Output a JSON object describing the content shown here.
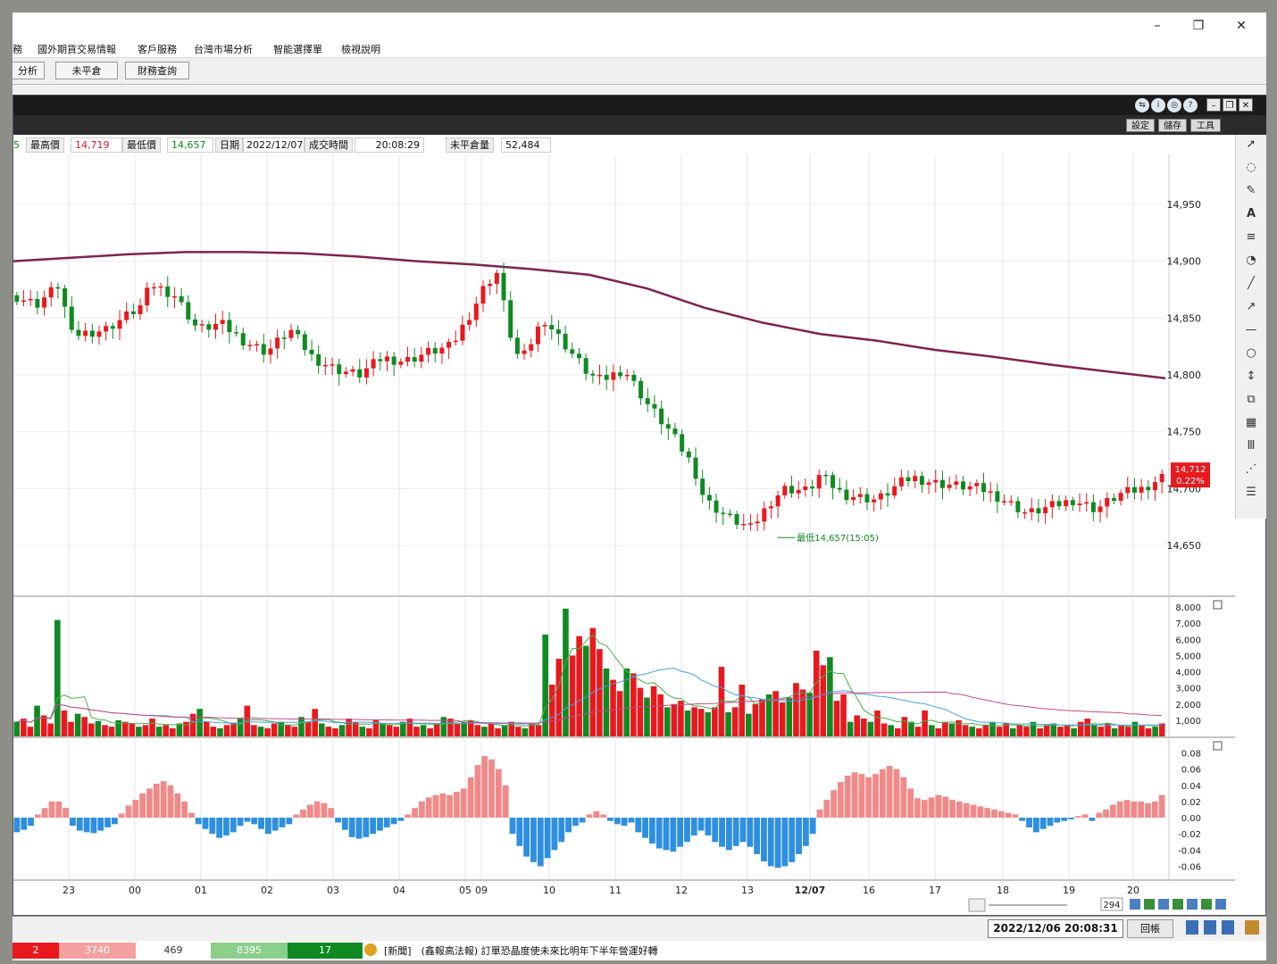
{
  "window": {
    "controls": {
      "minimize": "–",
      "restore": "❐",
      "close": "✕"
    }
  },
  "menu": [
    "務",
    "國外期貨交易情報",
    "客戶服務",
    "台灣市場分析",
    "智能選擇單",
    "檢視說明"
  ],
  "toolbar": [
    "分析",
    "未平倉",
    "財務查詢"
  ],
  "chart_window": {
    "title_buttons": [
      "設定",
      "儲存",
      "工具"
    ]
  },
  "quote": {
    "high_label": "最高價",
    "high_value": "14,719",
    "low_label": "最低價",
    "low_value": "14,657",
    "date_label": "日期",
    "date_value": "2022/12/07",
    "time_label": "成交時間",
    "time_value": "20:08:29",
    "oi_label": "未平倉量",
    "oi_value": "52,484"
  },
  "colors": {
    "up": "#e8191e",
    "down": "#0f8a22",
    "ma": "#7e2253",
    "macd_pos": "#f08a8a",
    "macd_neg": "#2e8fe0"
  },
  "chart_data": [
    {
      "type": "line",
      "title": "",
      "ylim": [
        14625,
        14975
      ],
      "yticks": [
        "14,950",
        "14,900",
        "14,850",
        "14,800",
        "14,750",
        "14,700",
        "14,650"
      ],
      "last_price_tag": "14,712",
      "last_change_tag": "0.22%",
      "low_annotation": "最低14,657(15:05)",
      "series": [
        {
          "x": [
            0,
            5,
            10,
            15,
            20,
            25,
            30,
            35,
            40,
            45,
            50,
            55,
            60,
            65,
            70,
            75,
            80,
            85,
            90,
            95,
            100
          ],
          "values": [
            14900,
            14903,
            14906,
            14908,
            14908,
            14907,
            14904,
            14900,
            14897,
            14893,
            14888,
            14876,
            14859,
            14846,
            14836,
            14830,
            14822,
            14816,
            14809,
            14803,
            14797
          ]
        },
        {
          "x": [
            0,
            2,
            4,
            5,
            8,
            11,
            12,
            14,
            16,
            18,
            20,
            22,
            24,
            26,
            28,
            30,
            32,
            34,
            36,
            38,
            40,
            41,
            42,
            43,
            44,
            46,
            48,
            50,
            51,
            53,
            55,
            57,
            59,
            60,
            62,
            64,
            66,
            67,
            69,
            70,
            72,
            75,
            77,
            78,
            80,
            84,
            86,
            88,
            90,
            92,
            94,
            96,
            98,
            100
          ],
          "values": [
            14870,
            14862,
            14880,
            14835,
            14840,
            14860,
            14880,
            14870,
            14840,
            14845,
            14830,
            14820,
            14840,
            14815,
            14805,
            14800,
            14815,
            14812,
            14820,
            14825,
            14860,
            14880,
            14890,
            14840,
            14810,
            14850,
            14825,
            14800,
            14795,
            14805,
            14775,
            14750,
            14720,
            14690,
            14675,
            14665,
            14692,
            14700,
            14698,
            14712,
            14695,
            14690,
            14705,
            14710,
            14705,
            14700,
            14690,
            14678,
            14684,
            14690,
            14682,
            14695,
            14700,
            14712
          ]
        }
      ]
    },
    {
      "type": "bar",
      "title": "",
      "ylim": [
        0,
        8500
      ],
      "yticks": [
        "8,000",
        "7,000",
        "6,000",
        "5,000",
        "4,000",
        "3,000",
        "2,000",
        "1,000"
      ],
      "series": [
        {
          "values": [
            900,
            1100,
            600,
            1900,
            1300,
            800,
            7200,
            1600,
            900,
            1400,
            1200,
            800,
            950,
            700,
            600,
            1000,
            900,
            800,
            600,
            700,
            1100,
            600,
            700,
            500,
            800,
            900,
            1400,
            1700,
            900,
            600,
            500,
            700,
            800,
            1100,
            1900,
            700,
            600,
            500,
            800,
            900,
            700,
            600,
            1200,
            900,
            1700,
            800,
            600,
            500,
            700,
            1100,
            900,
            600,
            500,
            1000,
            800,
            700,
            600,
            900,
            1100,
            600,
            700,
            500,
            800,
            1200,
            1100,
            800,
            900,
            1000,
            700,
            600,
            800,
            500,
            700,
            900,
            600,
            500,
            800,
            700,
            6300,
            3200,
            4800,
            7900,
            5000,
            6200,
            5600,
            6700,
            5400,
            4200,
            3500,
            2800,
            4200,
            3900,
            3000,
            2400,
            3100,
            2600,
            1800,
            2000,
            2200,
            1600,
            1800,
            1700,
            1500,
            1800,
            4300,
            1500,
            1800,
            3200,
            1400,
            2000,
            2300,
            2600,
            2800,
            2100,
            2400,
            3300,
            2900,
            2700,
            5300,
            4400,
            4900,
            2200,
            2600,
            900,
            1300,
            1100,
            900,
            1600,
            800,
            700,
            500,
            1200,
            900,
            600,
            1600,
            700,
            500,
            900,
            800,
            1000,
            700,
            600,
            500,
            700,
            900,
            600,
            800,
            500,
            700,
            600,
            900,
            500,
            700,
            800,
            600,
            700,
            500,
            900,
            1100,
            700,
            600,
            800,
            500,
            700,
            600,
            900,
            700,
            500,
            600,
            800
          ]
        }
      ]
    },
    {
      "type": "bar",
      "title": "",
      "ylim": [
        -0.065,
        0.085
      ],
      "yticks": [
        "0.08",
        "0.06",
        "0.04",
        "0.02",
        "0.00",
        "-0.02",
        "-0.04",
        "-0.06"
      ],
      "series": [
        {
          "values": [
            -0.018,
            -0.015,
            -0.01,
            0.004,
            0.012,
            0.02,
            0.02,
            0.012,
            -0.01,
            -0.016,
            -0.018,
            -0.019,
            -0.016,
            -0.012,
            -0.008,
            0.005,
            0.015,
            0.022,
            0.03,
            0.036,
            0.042,
            0.045,
            0.04,
            0.03,
            0.02,
            0.006,
            -0.008,
            -0.014,
            -0.02,
            -0.025,
            -0.022,
            -0.018,
            -0.01,
            -0.005,
            -0.008,
            -0.014,
            -0.02,
            -0.016,
            -0.012,
            -0.008,
            0.004,
            0.01,
            0.016,
            0.02,
            0.018,
            0.012,
            -0.006,
            -0.015,
            -0.024,
            -0.026,
            -0.024,
            -0.02,
            -0.016,
            -0.012,
            -0.008,
            -0.004,
            0.004,
            0.012,
            0.02,
            0.025,
            0.028,
            0.03,
            0.028,
            0.032,
            0.036,
            0.05,
            0.065,
            0.076,
            0.072,
            0.06,
            0.04,
            -0.02,
            -0.035,
            -0.048,
            -0.055,
            -0.06,
            -0.05,
            -0.04,
            -0.03,
            -0.018,
            -0.01,
            -0.006,
            0.004,
            0.008,
            0.004,
            -0.004,
            -0.008,
            -0.01,
            -0.006,
            -0.018,
            -0.025,
            -0.032,
            -0.038,
            -0.04,
            -0.042,
            -0.036,
            -0.03,
            -0.022,
            -0.016,
            -0.022,
            -0.03,
            -0.036,
            -0.04,
            -0.035,
            -0.03,
            -0.036,
            -0.045,
            -0.054,
            -0.06,
            -0.062,
            -0.06,
            -0.055,
            -0.045,
            -0.035,
            -0.02,
            0.01,
            0.022,
            0.034,
            0.044,
            0.052,
            0.056,
            0.054,
            0.05,
            0.054,
            0.06,
            0.064,
            0.06,
            0.05,
            0.036,
            0.024,
            0.022,
            0.025,
            0.028,
            0.026,
            0.022,
            0.02,
            0.018,
            0.016,
            0.014,
            0.012,
            0.01,
            0.008,
            0.006,
            0.004,
            -0.004,
            -0.012,
            -0.018,
            -0.014,
            -0.01,
            -0.006,
            -0.004,
            -0.002,
            0.002,
            0.004,
            -0.004,
            0.006,
            0.01,
            0.016,
            0.02,
            0.022,
            0.02,
            0.02,
            0.018,
            0.02,
            0.028
          ]
        }
      ]
    }
  ],
  "time_axis": [
    "23",
    "00",
    "01",
    "02",
    "03",
    "04",
    "05",
    "09",
    "10",
    "11",
    "12",
    "13",
    "12/07",
    "16",
    "17",
    "18",
    "19",
    "20"
  ],
  "scroll": {
    "zoom_value": "294"
  },
  "status": {
    "datetime": "2022/12/06 20:08:31",
    "back_label": "回帳"
  },
  "ticker": {
    "cells": [
      "2",
      "3740",
      "469",
      "8395",
      "17"
    ],
    "news": "[新聞]　(鑫報高法報) 訂單恐晶度使未來比明年下半年營運好轉"
  }
}
